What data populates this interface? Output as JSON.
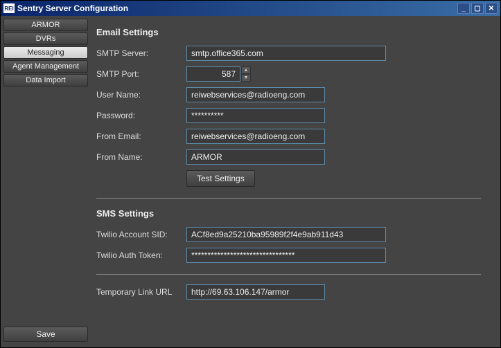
{
  "window": {
    "logo_text": "REI",
    "title": "Sentry Server Configuration"
  },
  "sidebar": {
    "items": [
      {
        "label": "ARMOR"
      },
      {
        "label": "DVRs"
      },
      {
        "label": "Messaging"
      },
      {
        "label": "Agent Management"
      },
      {
        "label": "Data Import"
      }
    ],
    "save_label": "Save"
  },
  "email": {
    "section_title": "Email Settings",
    "smtp_server_label": "SMTP Server:",
    "smtp_server_value": "smtp.office365.com",
    "smtp_port_label": "SMTP Port:",
    "smtp_port_value": "587",
    "username_label": "User Name:",
    "username_value": "reiwebservices@radioeng.com",
    "password_label": "Password:",
    "password_value": "**********",
    "from_email_label": "From Email:",
    "from_email_value": "reiwebservices@radioeng.com",
    "from_name_label": "From Name:",
    "from_name_value": "ARMOR",
    "test_button": "Test Settings"
  },
  "sms": {
    "section_title": "SMS Settings",
    "sid_label": "Twilio Account SID:",
    "sid_value": "ACf8ed9a25210ba95989f2f4e9ab911d43",
    "token_label": "Twilio Auth Token:",
    "token_value": "********************************"
  },
  "link": {
    "label": "Temporary Link URL",
    "value": "http://69.63.106.147/armor"
  }
}
